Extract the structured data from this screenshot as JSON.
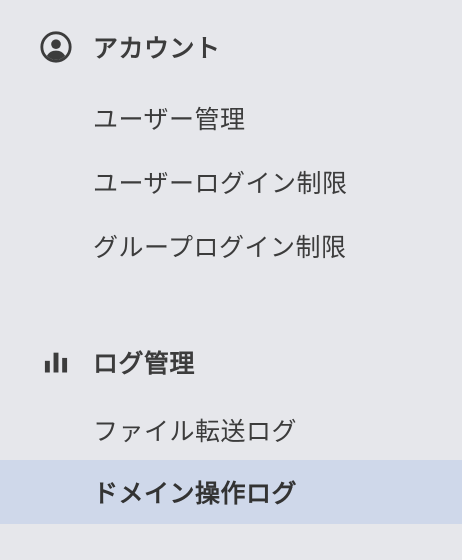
{
  "sections": [
    {
      "title": "アカウント",
      "icon": "account-circle-icon",
      "items": [
        {
          "label": "ユーザー管理",
          "active": false
        },
        {
          "label": "ユーザーログイン制限",
          "active": false
        },
        {
          "label": "グループログイン制限",
          "active": false
        }
      ]
    },
    {
      "title": "ログ管理",
      "icon": "bar-chart-icon",
      "items": [
        {
          "label": "ファイル転送ログ",
          "active": false
        },
        {
          "label": "ドメイン操作ログ",
          "active": true
        }
      ]
    }
  ],
  "colors": {
    "background": "#e6e7eb",
    "active_background": "#cfd8ea",
    "text": "#3c3c3c"
  }
}
